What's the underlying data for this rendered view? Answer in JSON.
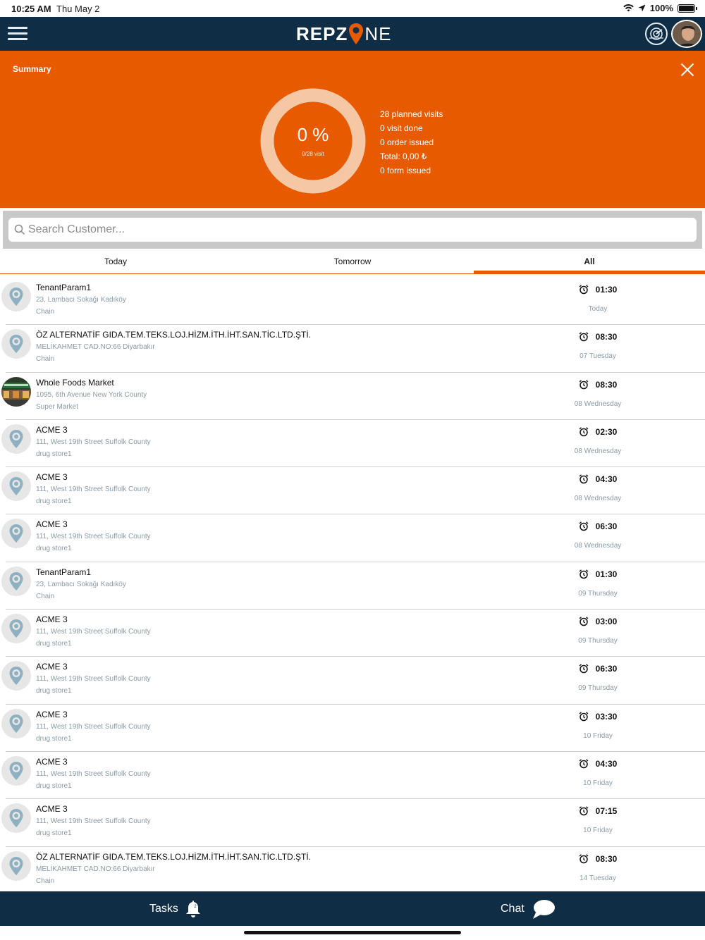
{
  "status_bar": {
    "time": "10:25 AM",
    "date": "Thu May 2",
    "battery": "100%"
  },
  "nav": {
    "logo_part1": "REPZ",
    "logo_part2": "NE"
  },
  "summary": {
    "title": "Summary",
    "progress_percent": 0,
    "percent_label": "0 %",
    "visit_label": "0/28 visit",
    "stats": [
      "28 planned visits",
      "0 visit done",
      "0 order issued",
      "Total: 0,00 ₺",
      "0 form issued"
    ]
  },
  "search": {
    "placeholder": "Search Customer..."
  },
  "tabs": [
    {
      "label": "Today",
      "selected": false
    },
    {
      "label": "Tomorrow",
      "selected": false
    },
    {
      "label": "All",
      "selected": true
    }
  ],
  "visits": [
    {
      "name": "TenantParam1",
      "address": "23, Lambacı Sokağı Kadıköy",
      "type": "Chain",
      "time": "01:30",
      "day": "Today",
      "photo": false
    },
    {
      "name": "ÖZ ALTERNATİF GIDA.TEM.TEKS.LOJ.HİZM.İTH.İHT.SAN.TİC.LTD.ŞTİ.",
      "address": "MELİKAHMET CAD.NO:66  Diyarbakır",
      "type": "Chain",
      "time": "08:30",
      "day": "07 Tuesday",
      "photo": false
    },
    {
      "name": "Whole Foods Market",
      "address": "1095, 6th Avenue New York County",
      "type": "Super Market",
      "time": "08:30",
      "day": "08 Wednesday",
      "photo": true
    },
    {
      "name": "ACME 3",
      "address": "111, West 19th Street Suffolk County",
      "type": "drug store1",
      "time": "02:30",
      "day": "08 Wednesday",
      "photo": false
    },
    {
      "name": "ACME 3",
      "address": "111, West 19th Street Suffolk County",
      "type": "drug store1",
      "time": "04:30",
      "day": "08 Wednesday",
      "photo": false
    },
    {
      "name": "ACME 3",
      "address": "111, West 19th Street Suffolk County",
      "type": "drug store1",
      "time": "06:30",
      "day": "08 Wednesday",
      "photo": false
    },
    {
      "name": "TenantParam1",
      "address": "23, Lambacı Sokağı Kadıköy",
      "type": "Chain",
      "time": "01:30",
      "day": "09 Thursday",
      "photo": false
    },
    {
      "name": "ACME 3",
      "address": "111, West 19th Street Suffolk County",
      "type": "drug store1",
      "time": "03:00",
      "day": "09 Thursday",
      "photo": false
    },
    {
      "name": "ACME 3",
      "address": "111, West 19th Street Suffolk County",
      "type": "drug store1",
      "time": "06:30",
      "day": "09 Thursday",
      "photo": false
    },
    {
      "name": "ACME 3",
      "address": "111, West 19th Street Suffolk County",
      "type": "drug store1",
      "time": "03:30",
      "day": "10 Friday",
      "photo": false
    },
    {
      "name": "ACME 3",
      "address": "111, West 19th Street Suffolk County",
      "type": "drug store1",
      "time": "04:30",
      "day": "10 Friday",
      "photo": false
    },
    {
      "name": "ACME 3",
      "address": "111, West 19th Street Suffolk County",
      "type": "drug store1",
      "time": "07:15",
      "day": "10 Friday",
      "photo": false
    },
    {
      "name": "ÖZ ALTERNATİF GIDA.TEM.TEKS.LOJ.HİZM.İTH.İHT.SAN.TİC.LTD.ŞTİ.",
      "address": "MELİKAHMET CAD.NO:66  Diyarbakır",
      "type": "Chain",
      "time": "08:30",
      "day": "14 Tuesday",
      "photo": false
    }
  ],
  "bottom_bar": {
    "tasks_label": "Tasks",
    "tasks_badge": "2",
    "chat_label": "Chat"
  },
  "icons": {
    "menu": "menu-icon",
    "radar": "radar-icon",
    "close": "close-icon",
    "search": "search-icon",
    "pin": "location-pin-icon",
    "alarm": "alarm-clock-icon",
    "bell": "bell-icon",
    "chat": "chat-bubble-icon"
  },
  "colors": {
    "navy": "#0f2d44",
    "accent": "#e75a00",
    "muted": "#8a9aa6"
  }
}
